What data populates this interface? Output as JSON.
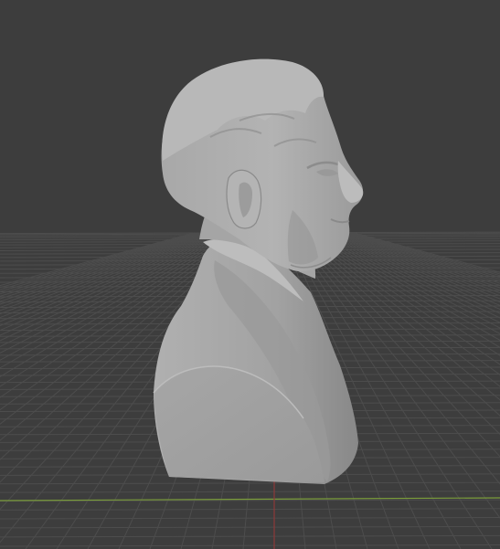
{
  "viewport": {
    "mode": "3d-viewport",
    "shading": "solid",
    "background_color": "#3d3d3d",
    "grid_color": "#4d4d4d",
    "x_axis_color": "#7a9c3a",
    "y_axis_color": "#8e3a3a",
    "object": {
      "name": "",
      "type": "mesh",
      "description_icon": "bust-sculpture-icon",
      "surface_color": "#a9a9a9"
    }
  }
}
